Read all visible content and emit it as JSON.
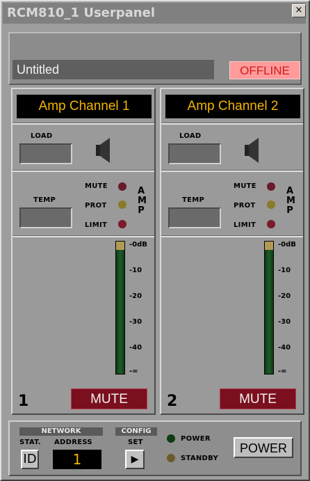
{
  "window": {
    "title": "RCM810_1 Userpanel",
    "close_label": "×"
  },
  "header": {
    "title_value": "Untitled",
    "status": "OFFLINE"
  },
  "channels": [
    {
      "name": "Amp Channel 1",
      "number": "1",
      "load_label": "LOAD",
      "temp_label": "TEMP",
      "mute_led": "MUTE",
      "prot_led": "PROT",
      "limit_led": "LIMIT",
      "amp": [
        "A",
        "M",
        "P"
      ],
      "mute_button": "MUTE"
    },
    {
      "name": "Amp Channel 2",
      "number": "2",
      "load_label": "LOAD",
      "temp_label": "TEMP",
      "mute_led": "MUTE",
      "prot_led": "PROT",
      "limit_led": "LIMIT",
      "amp": [
        "A",
        "M",
        "P"
      ],
      "mute_button": "MUTE"
    }
  ],
  "meter_scale": [
    "-0dB",
    "-10",
    "-20",
    "-30",
    "-40",
    "-∞"
  ],
  "bottom": {
    "network_label": "NETWORK",
    "stat_label": "STAT.",
    "address_label": "ADDRESS",
    "id_button": "ID",
    "address_value": "1",
    "config_label": "CONFIG",
    "set_label": "SET",
    "set_button": "▶",
    "power_led": "POWER",
    "standby_led": "STANDBY",
    "power_button": "POWER"
  },
  "colors": {
    "accent": "#f3b400",
    "offline": "#d21a1a",
    "mute": "#7a0f1e"
  }
}
